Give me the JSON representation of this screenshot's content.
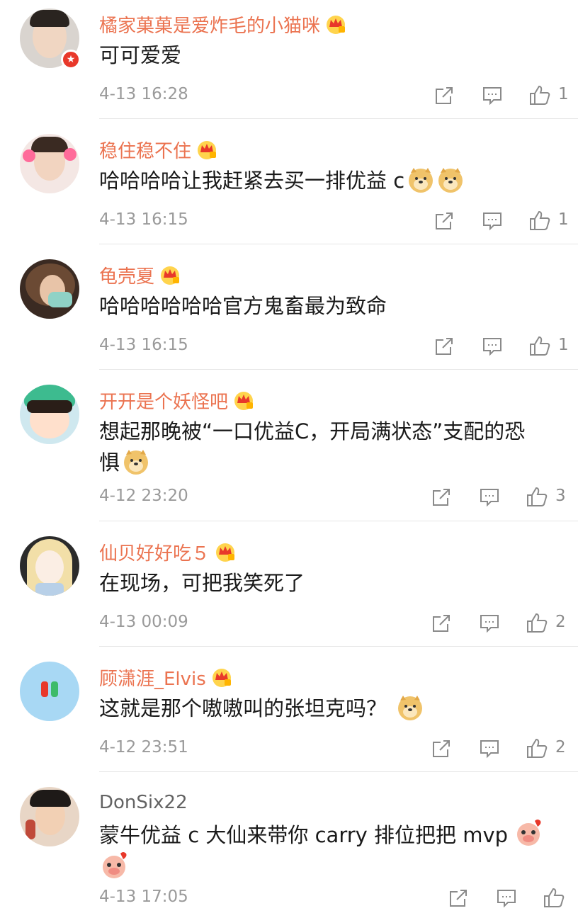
{
  "comments": [
    {
      "name": "橘家菓菓是爱炸毛的小猫咪",
      "text": "可可爱爱",
      "emojis": [],
      "extra_line": "",
      "extra_emojis": [],
      "time": "4-13 16:28",
      "likes": "1",
      "crown": true,
      "verified": true
    },
    {
      "name": "稳住稳不住",
      "text": "哈哈哈哈让我赶紧去买一排优益 c",
      "emojis": [
        "doge",
        "doge"
      ],
      "extra_line": "",
      "extra_emojis": [],
      "time": "4-13 16:15",
      "likes": "1",
      "crown": true,
      "verified": false
    },
    {
      "name": "龟壳夏",
      "text": "哈哈哈哈哈哈官方鬼畜最为致命",
      "emojis": [],
      "extra_line": "",
      "extra_emojis": [],
      "time": "4-13 16:15",
      "likes": "1",
      "crown": true,
      "verified": false
    },
    {
      "name": "开开是个妖怪吧",
      "text": "想起那晚被“一口优益C，开局满状态”支配的恐",
      "emojis": [],
      "extra_line": "惧",
      "extra_emojis": [
        "doge"
      ],
      "time": "4-12 23:20",
      "likes": "3",
      "crown": true,
      "verified": false
    },
    {
      "name": "仙贝好好吃５",
      "text": "在现场，可把我笑死了",
      "emojis": [],
      "extra_line": "",
      "extra_emojis": [],
      "time": "4-13 00:09",
      "likes": "2",
      "crown": true,
      "verified": false
    },
    {
      "name": "顾潇涯_Elvis",
      "text": "这就是那个嗷嗷叫的张坦克吗？",
      "emojis": [
        "doge"
      ],
      "extra_line": "",
      "extra_emojis": [],
      "time": "4-12 23:51",
      "likes": "2",
      "crown": true,
      "verified": false
    },
    {
      "name": "DonSix22",
      "text": "蒙牛优益 c 大仙来带你 carry 排位把把 mvp",
      "emojis": [
        "pig"
      ],
      "extra_line": "",
      "extra_emojis": [
        "pig"
      ],
      "time": "4-13 17:05",
      "likes": "",
      "crown": false,
      "verified": false
    }
  ],
  "icons": {
    "share": "share-icon",
    "comment": "comment-icon",
    "like": "like-icon"
  },
  "colors": {
    "name": "#eb7350",
    "time": "#9a9a9a",
    "divider": "#e6e6e6"
  }
}
